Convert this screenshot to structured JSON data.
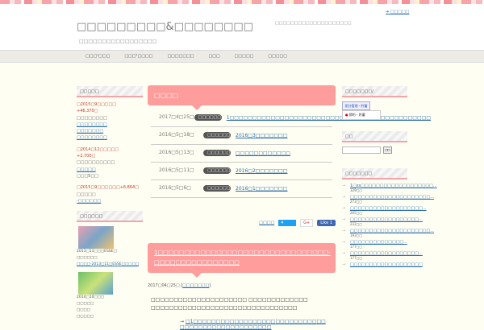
{
  "header": {
    "toplink": "□□□□□",
    "title": "□□□□□□□□□&□□□□□□□□",
    "description": "□□□□□□□□□□□□□□□□□",
    "tagline": "□□□□□□□□□□□□□□□□□□□□"
  },
  "nav": [
    "□□□¹□□□",
    "□□□¹□□□□",
    "□□□□□□□",
    "□□□",
    "□□□□□",
    "□□□□□"
  ],
  "left": {
    "w1_title": "□□□□□",
    "w1_lines": [
      {
        "t": "□2015□9□□□□□",
        "c": "red"
      },
      {
        "t": "+46,370□",
        "c": "red"
      },
      {
        "t": "□□□□□□□□",
        "c": ""
      },
      {
        "t": "□□□□□□□□",
        "c": "link"
      },
      {
        "t": "□□□□□□□",
        "c": "link"
      },
      {
        "t": "□□□□□□□□",
        "c": "link"
      },
      {
        "t": "",
        "c": ""
      },
      {
        "t": "□2014□12□□□□□",
        "c": "red"
      },
      {
        "t": "+2,700□",
        "c": "red"
      },
      {
        "t": "□□□□□□□□□□",
        "c": ""
      },
      {
        "t": "□□□□□",
        "c": "link"
      },
      {
        "t": "□□□5□□",
        "c": ""
      },
      {
        "t": "",
        "c": ""
      },
      {
        "t": "□2015□9□□□□□□+6,864□",
        "c": "red"
      },
      {
        "t": "□□□□□",
        "c": ""
      },
      {
        "t": "-□□□□□□",
        "c": "link"
      }
    ],
    "w2_title": "□□□□□□",
    "p1_caption": "2013□11□□□ESSE□",
    "p1_l2": "□□□□□□",
    "p1_l3": "□□□□-2013□11□ESSE□□□□□",
    "p2_caption": "2014□10□□□",
    "p2_l2": "□□□□□",
    "p2_l3": "□□□□",
    "p2_l4": "□□□□□"
  },
  "main": {
    "news_title": "□□□□",
    "news": [
      {
        "date": "2017□4□25□",
        "badge": "□□□□□□",
        "title": "1□□□□□□□□□□□□□□□□□□□□□□□□□□□□□□□□□□□□□□□□□□□□"
      },
      {
        "date": "2016□5□18□",
        "badge": "□□□□□□",
        "title": "2016□3□□□□□□□"
      },
      {
        "date": "2016□5□13□",
        "badge": "□□□□□□",
        "title": "□□□□□□□□□□□□"
      },
      {
        "date": "2016□5□11□",
        "badge": "□□□□□□",
        "title": "2016□2□□□□□□□"
      },
      {
        "date": "2016□5□6□",
        "badge": "□□□□□□",
        "title": "2016□1□□□□□□□"
      }
    ],
    "share_label": "□□□□",
    "tweet_count": "4",
    "gplus": "G+",
    "like": "Like 1",
    "post_title": "1□□□□□□□□□□□□□□□□□□□□□□□□□□□□□□□□-□□□□□□□□□□□□□□□□",
    "post_date": "2017□04□25□",
    "post_cat": "□□□□□□□",
    "post_body": "□□□□□□□□□□□□□□□□□□□□□ □□□□□□□□□□□□□ □□□□□□□□□□□□□□□□□□□□□□□□□□□□□□□□",
    "post_link": "□1□□□□□□□□□□□□□□□□□□□□□□□□□□□□□ □□□□□□□□□□□□□□□□□□□□"
  },
  "right": {
    "w1_title": "□□□□□□□/",
    "banner1": "家計管理・貯蓄",
    "banner2": "節約・貯蓄",
    "search_title": "□□",
    "search_button": "□□",
    "search_value": "",
    "rank_title": "□□□□□□□",
    "rank": [
      {
        "t": "1□ss□□□□□□□□□□□□□□□□□□□...",
        "v": "329□□"
      },
      {
        "t": "□□□□□□□□□□□□□□□□□□□□□...",
        "v": "273□□"
      },
      {
        "t": "□□□□□□□□□□□□□□□□□□□...",
        "v": "265□□"
      },
      {
        "t": "□□□□□□□□□□□□□□□□□□...",
        "v": "232□□"
      },
      {
        "t": "□□□□□□□□□□□□□□□□□□□□□...",
        "v": "193□□"
      },
      {
        "t": "□□□□□□□□□□□□□□...",
        "v": "177□□"
      },
      {
        "t": "□□□□□□□□□□□□□□□□□□...",
        "v": "177□□"
      },
      {
        "t": "□□□□□□□□□□□□□□□□□□□",
        "v": ""
      }
    ]
  }
}
